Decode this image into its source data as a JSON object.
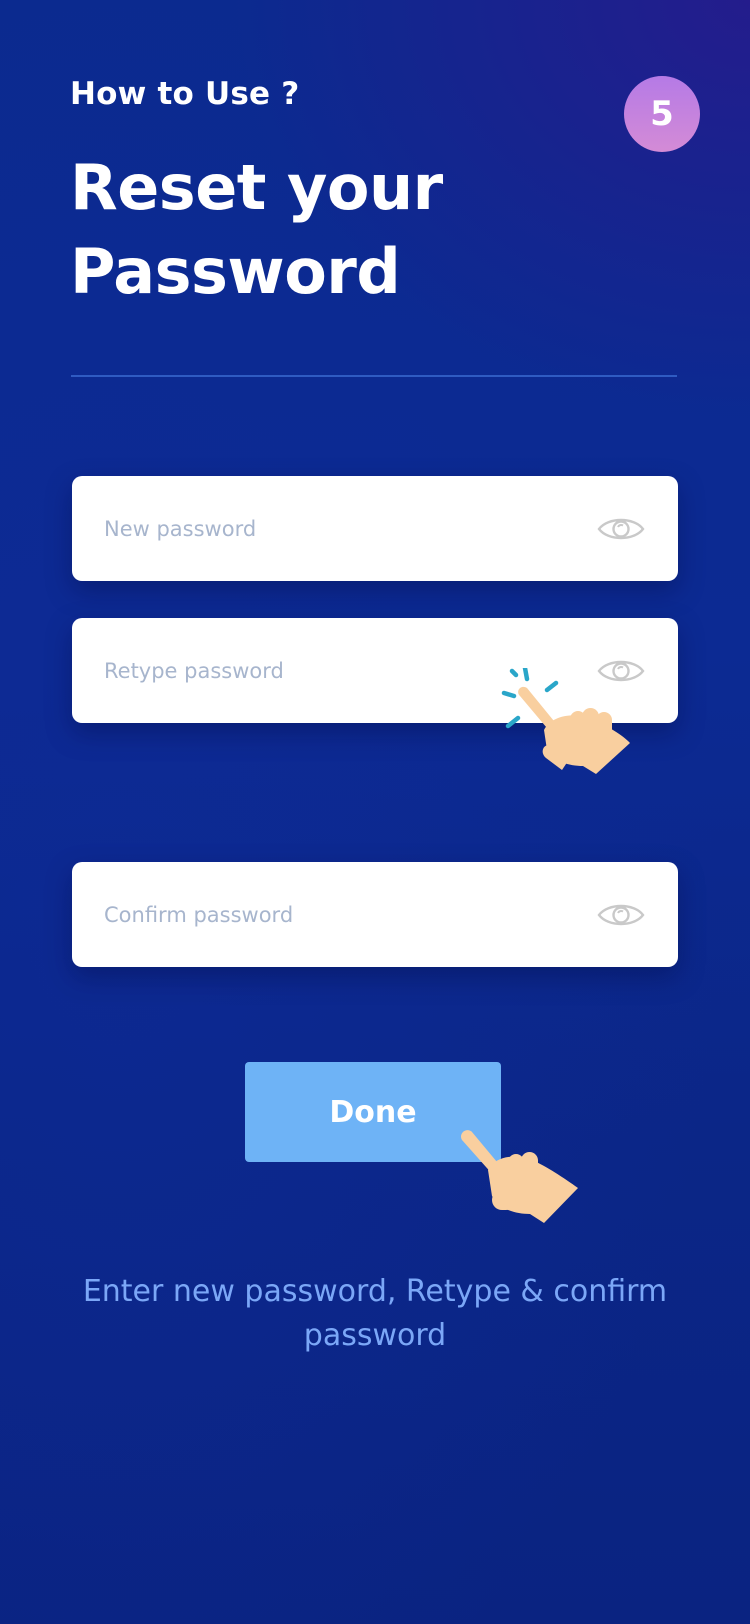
{
  "header": {
    "eyebrow": "How to Use ?",
    "step_number": "5",
    "title": "Reset your Password"
  },
  "fields": [
    {
      "placeholder": "New password",
      "value": "",
      "icon": "eye-icon"
    },
    {
      "placeholder": "Retype password",
      "value": "",
      "icon": "eye-icon"
    },
    {
      "placeholder": "Confirm password",
      "value": "",
      "icon": "eye-icon"
    }
  ],
  "done_button": {
    "label": "Done"
  },
  "hint": "Enter new password, Retype & confirm password",
  "colors": {
    "background": "#0b2a8f",
    "badge": "#c084e0",
    "button": "#6eb3f6",
    "hint_text": "#7ba7f7",
    "placeholder": "#a7b5cd",
    "tap_burst": "#2aa6c9",
    "hand_skin": "#f9cf9f"
  }
}
